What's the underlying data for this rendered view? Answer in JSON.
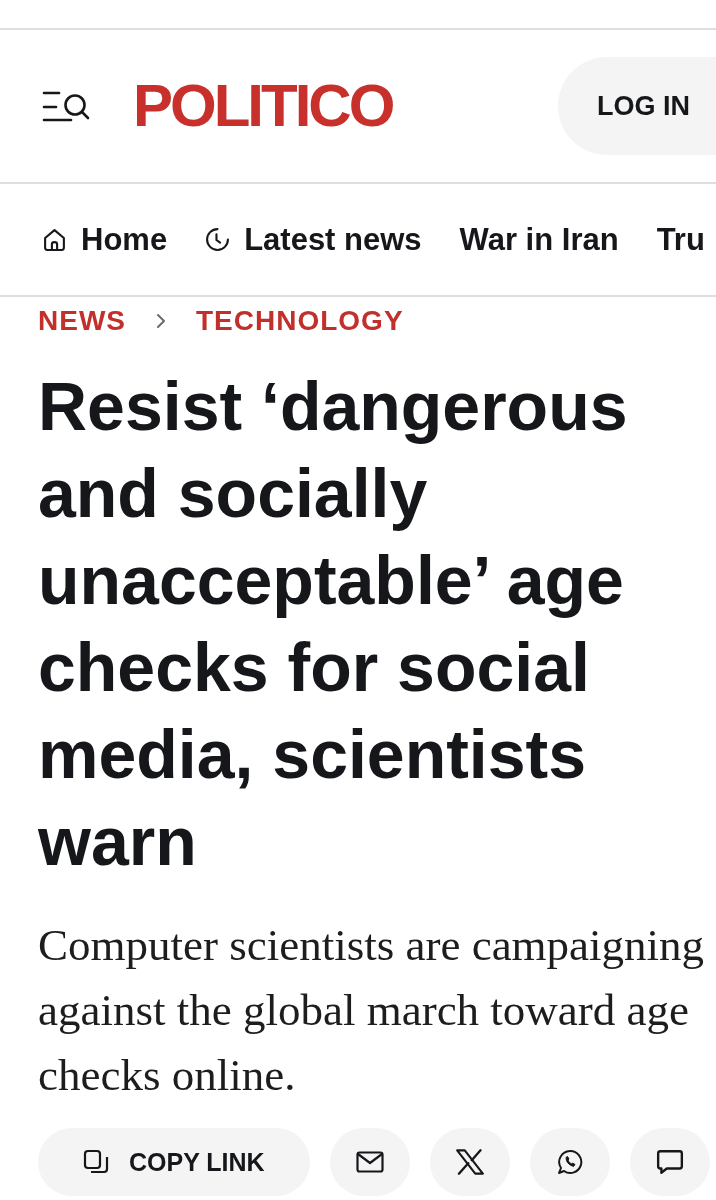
{
  "header": {
    "logo": "POLITICO",
    "login_button": "LOG IN"
  },
  "nav": {
    "items": [
      {
        "kind": "home",
        "label": "Home"
      },
      {
        "kind": "latest",
        "label": "Latest news"
      },
      {
        "kind": "section",
        "label": "War in Iran"
      },
      {
        "kind": "section",
        "label": "Tru"
      }
    ]
  },
  "breadcrumb": [
    "NEWS",
    "TECHNOLOGY"
  ],
  "article": {
    "headline": "Resist ‘dangerous and socially unacceptable’ age checks for social media, scientists warn",
    "summary": "Computer scientists are campaigning against the global march toward age checks online."
  },
  "share_bar": {
    "copy_link": "COPY LINK",
    "buttons": [
      {
        "kind": "email"
      },
      {
        "kind": "x"
      },
      {
        "kind": "whatsapp"
      },
      {
        "kind": "message"
      }
    ]
  }
}
